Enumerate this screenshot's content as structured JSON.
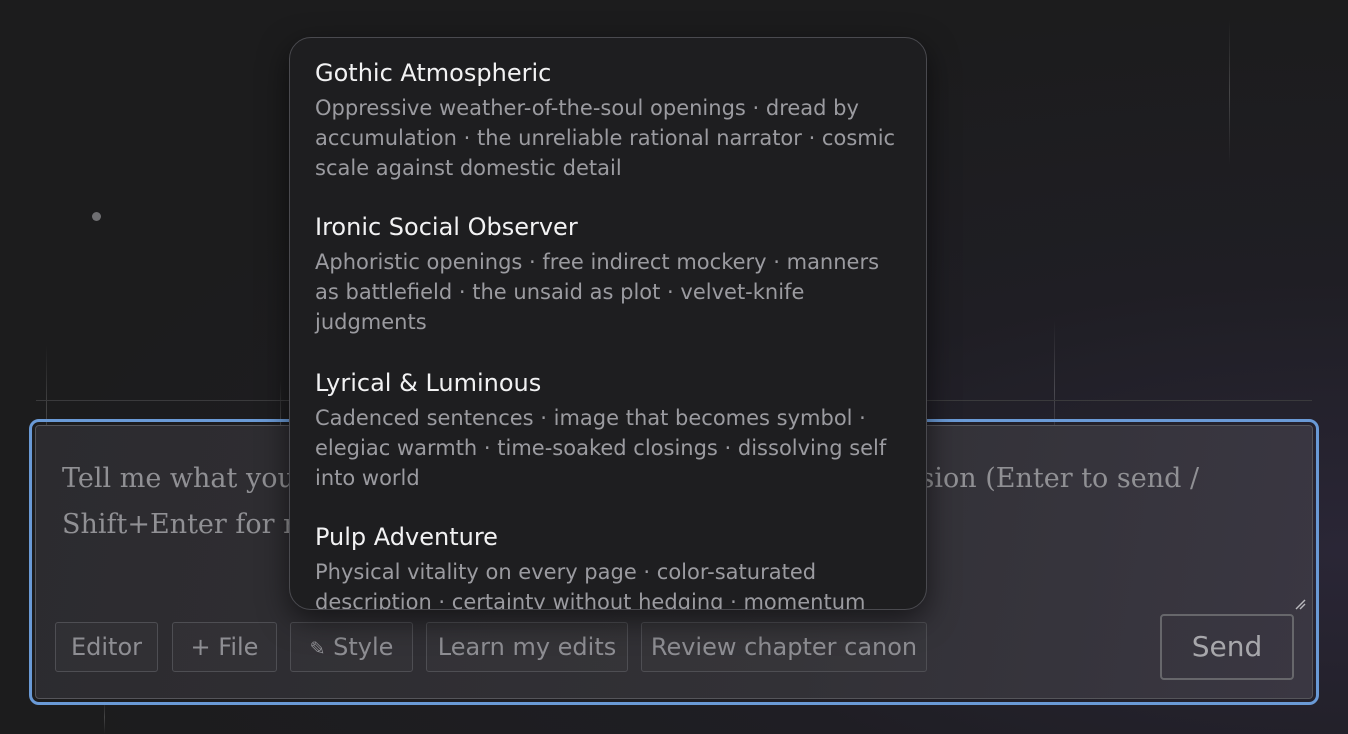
{
  "composer": {
    "placeholder": "Tell me what you want — describe a scene, a chapter, or a revision (Enter to send / Shift+Enter for newline)",
    "buttons": {
      "editor": "Editor",
      "file": "+ File",
      "style": "Style",
      "learn_edits": "Learn my edits",
      "review_canon": "Review chapter canon",
      "send": "Send"
    },
    "icons": {
      "style_icon": "pencil-icon"
    }
  },
  "style_menu": {
    "items": [
      {
        "name": "Gothic Atmospheric",
        "description": "Oppressive weather-of-the-soul openings · dread by accumulation · the unreliable rational narrator · cosmic scale against domestic detail"
      },
      {
        "name": "Ironic Social Observer",
        "description": "Aphoristic openings · free indirect mockery · manners as battlefield · the unsaid as plot · velvet-knife judgments"
      },
      {
        "name": "Lyrical & Luminous",
        "description": "Cadenced sentences · image that becomes symbol · elegiac warmth · time-soaked closings · dissolving self into world"
      },
      {
        "name": "Pulp Adventure",
        "description": "Physical vitality on every page · color-saturated description · certainty without hedging · momentum"
      }
    ]
  },
  "colors": {
    "focus_border": "#6a9ad6",
    "background": "#1c1c1d",
    "menu_background": "#1e1e20"
  }
}
